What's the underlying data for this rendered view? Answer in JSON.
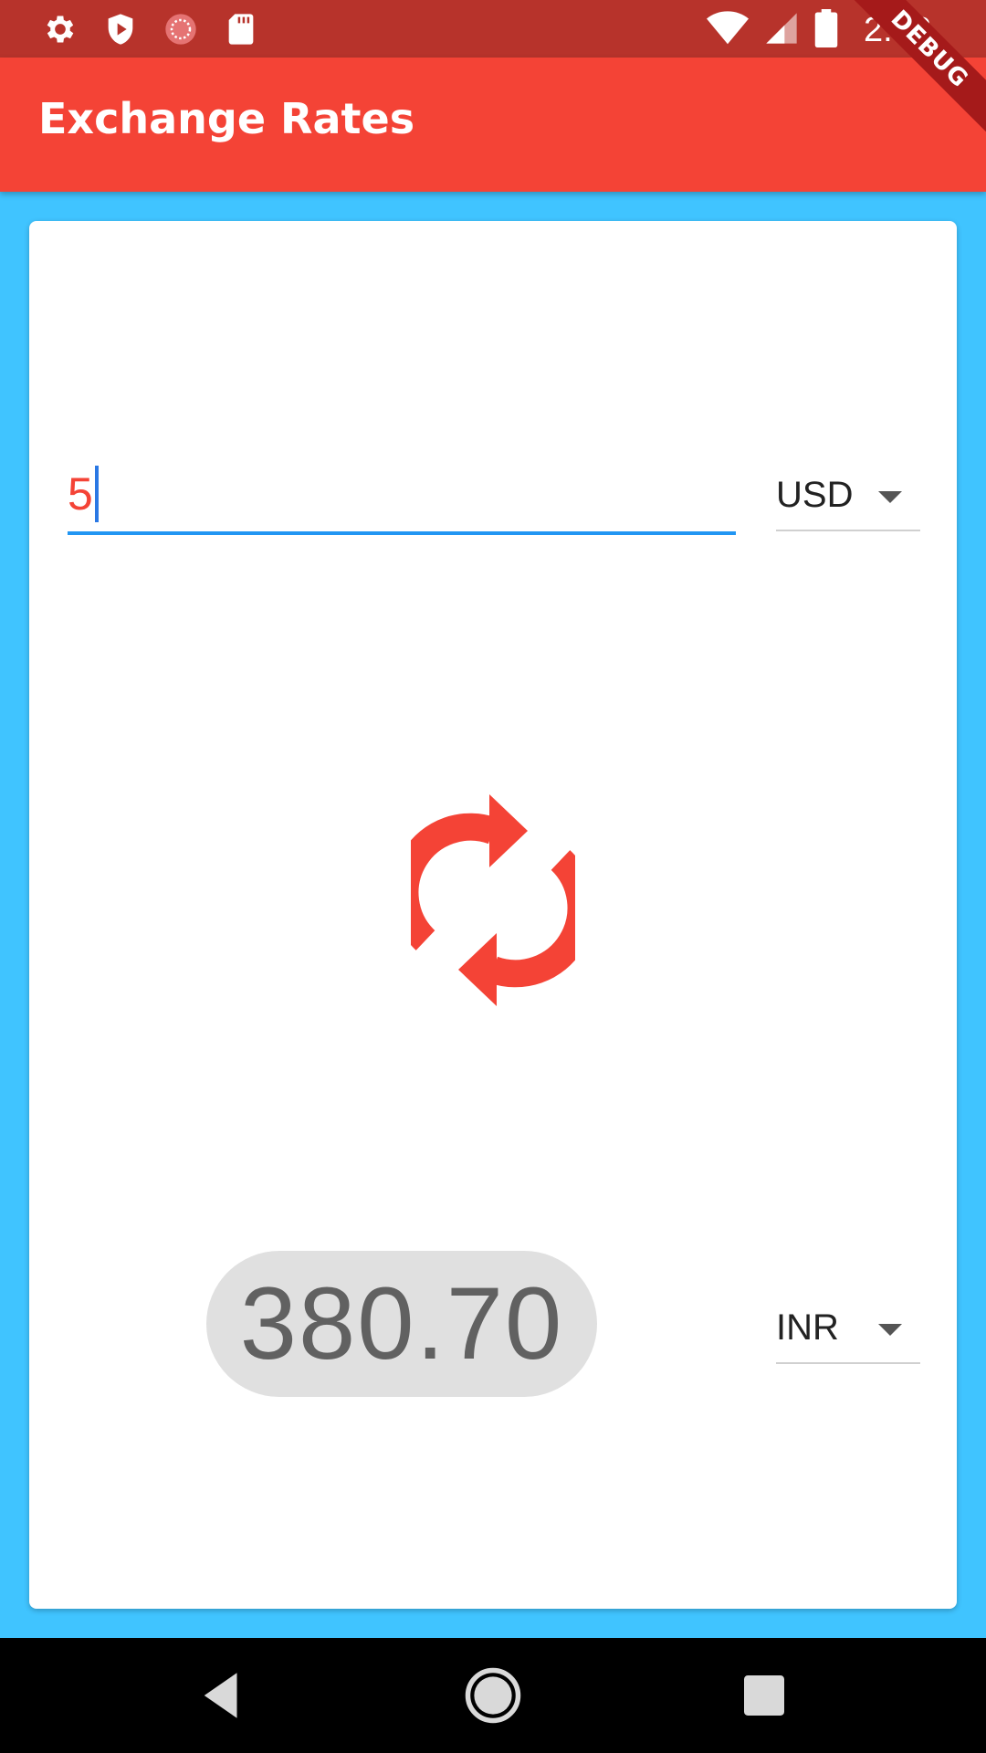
{
  "status_bar": {
    "time": "2:48",
    "left_icons": [
      "settings-icon",
      "shield-play-icon",
      "loading-circle-icon",
      "sd-card-icon"
    ],
    "right_icons": [
      "wifi-icon",
      "signal-icon",
      "battery-icon"
    ]
  },
  "app_bar": {
    "title": "Exchange Rates",
    "debug_banner": "DEBUG"
  },
  "converter": {
    "amount_value": "5",
    "from_currency": "USD",
    "to_currency": "INR",
    "swap_icon": "sync-icon",
    "result": "380.70"
  },
  "navigation": {
    "icons": [
      "back-icon",
      "home-icon",
      "recents-icon"
    ]
  },
  "colors": {
    "primary": "#f44336",
    "status_bar": "#b7332b",
    "background": "#40c4ff",
    "input_underline": "#2196f3",
    "result_pill": "#e0e0e0"
  }
}
